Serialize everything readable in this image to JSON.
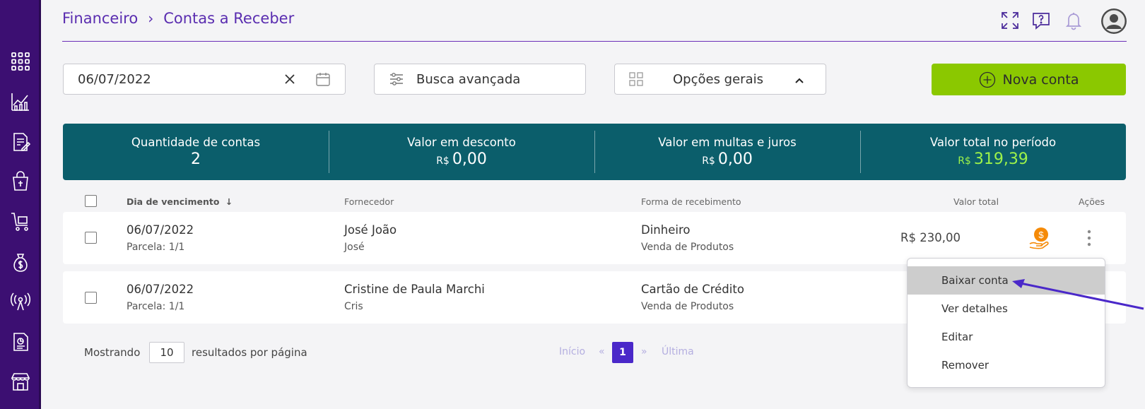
{
  "breadcrumb": {
    "root": "Financeiro",
    "separator": "›",
    "current": "Contas a Receber"
  },
  "header_icons": [
    "expand-icon",
    "help-chat-icon",
    "bell-icon",
    "user-avatar-icon"
  ],
  "sidebar": {
    "icons": [
      "apps-grid-icon",
      "chart-icon",
      "document-edit-icon",
      "shopping-bag-icon",
      "cart-icon",
      "money-bag-icon",
      "broadcast-icon",
      "report-icon",
      "store-icon"
    ]
  },
  "filters": {
    "date_value": "06/07/2022",
    "advanced_search_label": "Busca avançada",
    "general_options_label": "Opções gerais",
    "new_account_label": "Nova conta"
  },
  "summary": [
    {
      "label": "Quantidade de contas",
      "currency": "",
      "value": "2"
    },
    {
      "label": "Valor em desconto",
      "currency": "R$",
      "value": "0,00"
    },
    {
      "label": "Valor em multas e juros",
      "currency": "R$",
      "value": "0,00"
    },
    {
      "label": "Valor total no período",
      "currency": "R$",
      "value": "319,39"
    }
  ],
  "table": {
    "headers": {
      "due_date": "Dia de vencimento",
      "sort_arrow": "↓",
      "supplier": "Fornecedor",
      "payment": "Forma de recebimento",
      "total": "Valor total",
      "actions": "Ações"
    },
    "rows": [
      {
        "date": "06/07/2022",
        "parcel": "Parcela: 1/1",
        "supplier": "José João",
        "supplier_short": "José",
        "payment": "Dinheiro",
        "category": "Venda de Produtos",
        "total": "R$ 230,00"
      },
      {
        "date": "06/07/2022",
        "parcel": "Parcela: 1/1",
        "supplier": "Cristine de Paula Marchi",
        "supplier_short": "Cris",
        "payment": "Cartão de Crédito",
        "category": "Venda de Produtos",
        "total": ""
      }
    ]
  },
  "pagination": {
    "showing_label": "Mostrando",
    "per_page_value": "10",
    "per_page_label": "resultados por página",
    "first": "Início",
    "prev": "«",
    "current_page": "1",
    "next": "»",
    "last": "Última"
  },
  "action_menu": {
    "items": [
      "Baixar conta",
      "Ver detalhes",
      "Editar",
      "Remover"
    ],
    "active_index": 0
  },
  "colors": {
    "sidebar": "#3c0f72",
    "accent_purple": "#5a2db0",
    "summary_bg": "#0b5e6b",
    "new_button": "#8bc800",
    "highlight_green": "#9df24a",
    "pay_icon": "#f58a07"
  }
}
